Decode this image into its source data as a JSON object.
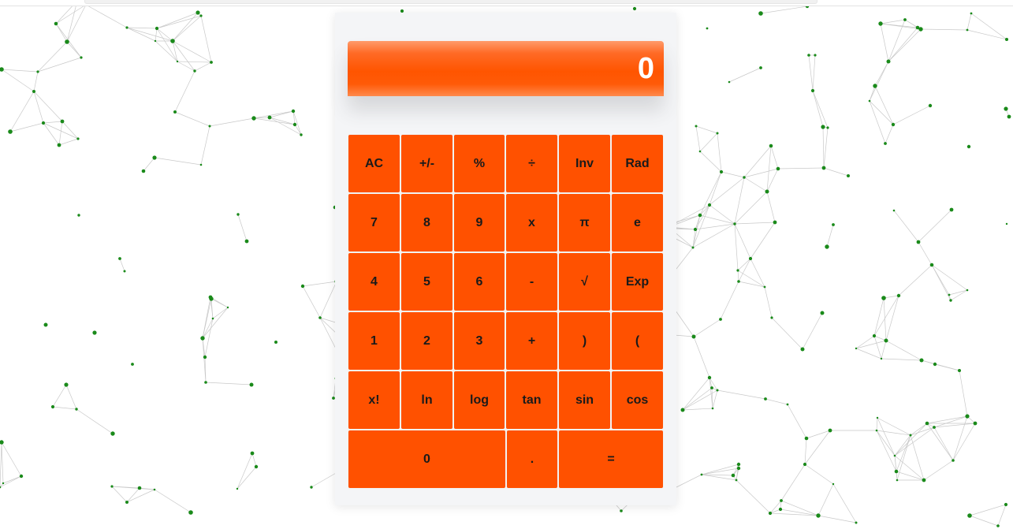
{
  "calculator": {
    "display": "0",
    "rows": [
      [
        "AC",
        "+/-",
        "%",
        "÷",
        "Inv",
        "Rad"
      ],
      [
        "7",
        "8",
        "9",
        "x",
        "π",
        "e"
      ],
      [
        "4",
        "5",
        "6",
        "-",
        "√",
        "Exp"
      ],
      [
        "1",
        "2",
        "3",
        "+",
        ")",
        "("
      ],
      [
        "x!",
        "ln",
        "log",
        "tan",
        "sin",
        "cos"
      ],
      [
        "0",
        ".",
        "="
      ]
    ]
  },
  "colors": {
    "accent": "#ff5100",
    "dot": "#1a8a1a",
    "line": "#c9c9c9"
  }
}
